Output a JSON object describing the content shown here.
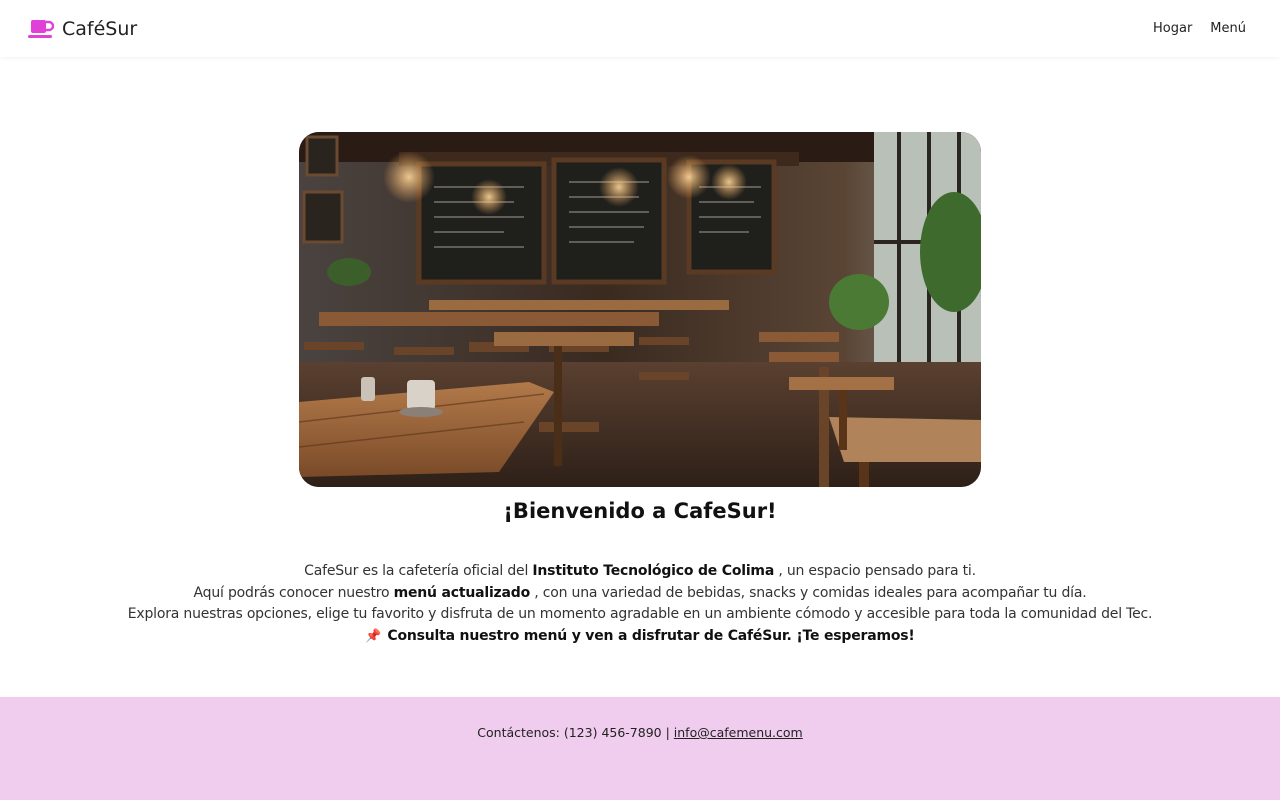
{
  "header": {
    "brand": "CaféSur",
    "logo_icon": "coffee-cup-icon",
    "accent_color": "#e040d8",
    "nav": [
      "Hogar",
      "Menú"
    ]
  },
  "hero": {
    "image_icon": "cafe-interior-photo"
  },
  "main": {
    "title": "¡Bienvenido a CafeSur!",
    "line1_pre": "CafeSur es la cafetería oficial del ",
    "line1_bold": "Instituto Tecnológico de Colima",
    "line1_post": " , un espacio pensado para ti.",
    "line2_pre": "Aquí podrás conocer nuestro ",
    "line2_bold": "menú actualizado",
    "line2_post": " , con una variedad de bebidas, snacks y comidas ideales para acompañar tu día.",
    "line3": "Explora nuestras opciones, elige tu favorito y disfruta de un momento agradable en un ambiente cómodo y accesible para toda la comunidad del Tec.",
    "line4_icon": "pushpin-icon",
    "line4_bold": "Consulta nuestro menú y ven a disfrutar de CaféSur. ¡Te esperamos!"
  },
  "footer": {
    "contact_prefix": "Contáctenos: (123) 456-7890 | ",
    "email": "info@cafemenu.com",
    "background": "#f0cdee"
  }
}
